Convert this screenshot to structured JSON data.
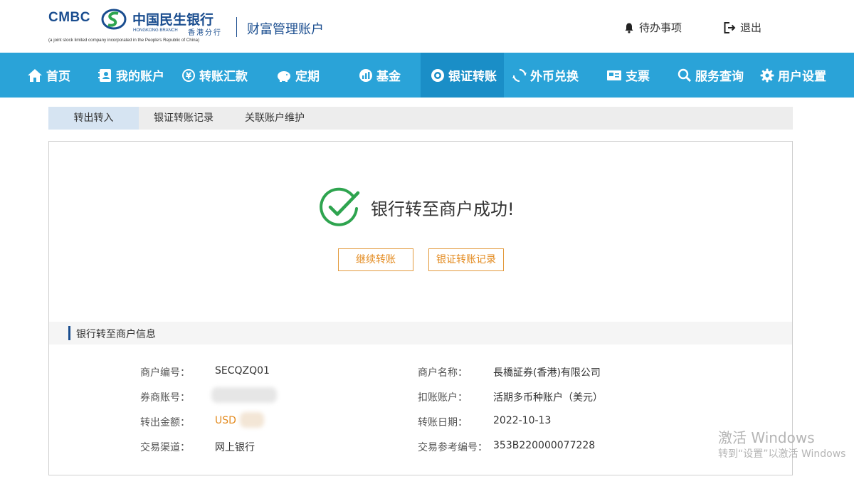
{
  "header": {
    "logo_en": "CMBC",
    "logo_cn": "中国民生银行",
    "branch_en": "HONGKONG BRANCH",
    "branch_cn": "香港分行",
    "legal_notice": "(a joint stock limited company incorporated in the People's Republic of China)",
    "portal_title": "财富管理账户",
    "todo_label": "待办事项",
    "logout_label": "退出",
    "brand_color": "#1a4d8f"
  },
  "nav": {
    "color": "#2aa3d8",
    "active_color": "#1a8ec7",
    "items": [
      {
        "label": "首页",
        "icon": "home-icon"
      },
      {
        "label": "我的账户",
        "icon": "account-book-icon"
      },
      {
        "label": "转账汇款",
        "icon": "yen-transfer-icon"
      },
      {
        "label": "定期",
        "icon": "piggy-bank-icon"
      },
      {
        "label": "基金",
        "icon": "fund-chart-icon"
      },
      {
        "label": "银证转账",
        "icon": "target-icon",
        "active": true
      },
      {
        "label": "外币兑换",
        "icon": "exchange-icon"
      },
      {
        "label": "支票",
        "icon": "cheque-icon"
      },
      {
        "label": "服务查询",
        "icon": "search-icon"
      },
      {
        "label": "用户设置",
        "icon": "gear-icon"
      }
    ]
  },
  "subtabs": [
    {
      "label": "转出转入",
      "active": true
    },
    {
      "label": "银证转账记录"
    },
    {
      "label": "关联账户维护"
    }
  ],
  "result": {
    "message": "银行转至商户成功!",
    "continue_button": "继续转账",
    "records_button": "银证转账记录",
    "accent_color": "#e38a1e",
    "success_color": "#2ea44f"
  },
  "info": {
    "section_title": "银行转至商户信息",
    "fields": [
      {
        "label": "商户编号：",
        "value": "SECQZQ01"
      },
      {
        "label": "商户名称：",
        "value": "長橋証券(香港)有限公司"
      },
      {
        "label": "券商账号：",
        "value": ""
      },
      {
        "label": "扣账账户：",
        "value": "活期多币种账户（美元）"
      },
      {
        "label": "转出金额：",
        "value": "USD"
      },
      {
        "label": "转账日期：",
        "value": "2022-10-13"
      },
      {
        "label": "交易渠道：",
        "value": "网上银行"
      },
      {
        "label": "交易参考编号：",
        "value": "353B220000077228"
      }
    ]
  },
  "watermark": {
    "line1": "激活 Windows",
    "line2": "转到“设置”以激活 Windows"
  }
}
